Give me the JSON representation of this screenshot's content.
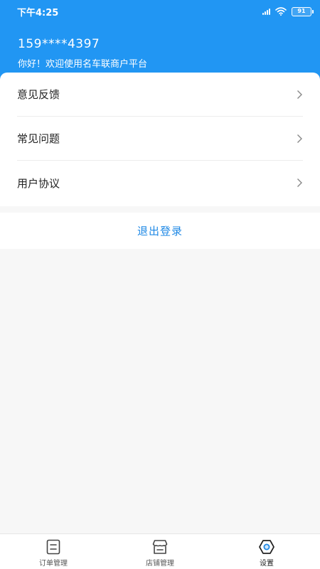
{
  "status_bar": {
    "time": "下午4:25",
    "battery": "91",
    "icons": [
      "signal-icon",
      "wifi-icon",
      "battery-icon"
    ]
  },
  "header": {
    "phone": "159****4397",
    "greeting": "你好！欢迎使用名车联商户平台"
  },
  "menu": {
    "items": [
      {
        "label": "意见反馈",
        "icon": "chevron-right-icon"
      },
      {
        "label": "常见问题",
        "icon": "chevron-right-icon"
      },
      {
        "label": "用户协议",
        "icon": "chevron-right-icon"
      }
    ]
  },
  "logout": {
    "label": "退出登录"
  },
  "tabs": [
    {
      "label": "订单管理",
      "icon": "order-list-icon"
    },
    {
      "label": "店铺管理",
      "icon": "store-icon"
    },
    {
      "label": "设置",
      "icon": "settings-gear-icon",
      "active": true
    }
  ],
  "colors": {
    "header_bg": "#2196f3",
    "accent": "#1e88e5",
    "page_bg": "#f7f7f7"
  }
}
